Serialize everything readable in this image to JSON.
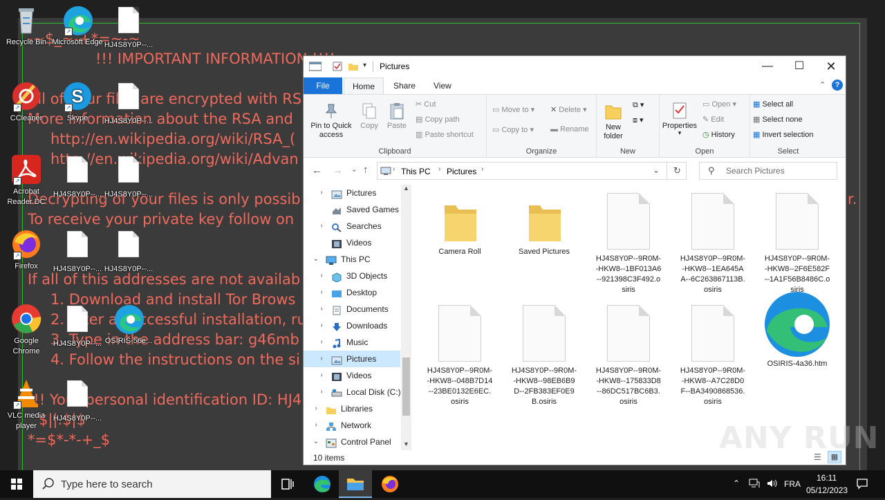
{
  "colors": {
    "note_text": "#f06a5c",
    "note_bg": "#3b3b3b",
    "note_border": "#2dbd2d",
    "accent": "#1a73d9",
    "selected": "#cce8ff"
  },
  "desktop": {
    "note_lines": [
      "-~$_~-+*=~-~",
      "!!! IMPORTANT INFORMATION !!!!",
      "All of your files are encrypted with RS",
      "More information about the RSA and",
      "http://en.wikipedia.org/wiki/RSA_(",
      "http://en.wikipedia.org/wiki/Advan",
      "Decrypting of your files is only possib",
      "To receive your private key follow on",
      "If all of this addresses are not availab",
      "1. Download and install Tor Brows",
      "2. After a successful installation, ru",
      "3. Type in the address bar: g46mb",
      "4. Follow the instructions on the si",
      "!!! Your personal identification ID: HJ4",
      "$||.$|$",
      "*=$*-*-+_$",
      "r."
    ],
    "icons": [
      {
        "label": "Recycle Bin",
        "icon": "recycle-bin-icon"
      },
      {
        "label": "Microsoft Edge",
        "icon": "edge-icon"
      },
      {
        "label": "HJ4S8Y0P--...",
        "icon": "file-icon"
      },
      {
        "label": "CCleaner",
        "icon": "ccleaner-icon"
      },
      {
        "label": "Skype",
        "icon": "skype-icon"
      },
      {
        "label": "HJ4S8Y0P--...",
        "icon": "file-icon"
      },
      {
        "label": "Acrobat Reader DC",
        "icon": "acrobat-icon"
      },
      {
        "label": "HJ4S8Y0P--...",
        "icon": "file-icon"
      },
      {
        "label": "HJ4S8Y0P--...",
        "icon": "file-icon"
      },
      {
        "label": "Firefox",
        "icon": "firefox-icon"
      },
      {
        "label": "HJ4S8Y0P--...",
        "icon": "file-icon"
      },
      {
        "label": "HJ4S8Y0P--...",
        "icon": "file-icon"
      },
      {
        "label": "Google Chrome",
        "icon": "chrome-icon"
      },
      {
        "label": "HJ4S8Y0P--...",
        "icon": "file-icon"
      },
      {
        "label": "OSIRIS-56e...",
        "icon": "edge-icon"
      },
      {
        "label": "VLC media player",
        "icon": "vlc-icon"
      },
      {
        "label": "HJ4S8Y0P--...",
        "icon": "file-icon"
      }
    ]
  },
  "explorer": {
    "title": "Pictures",
    "tabs": [
      "File",
      "Home",
      "Share",
      "View"
    ],
    "active_tab": "Home",
    "ribbon": {
      "clipboard": {
        "group": "Clipboard",
        "pin": "Pin to Quick access",
        "copy": "Copy",
        "paste": "Paste",
        "cut": "Cut",
        "copy_path": "Copy path",
        "paste_shortcut": "Paste shortcut"
      },
      "organize": {
        "group": "Organize",
        "move_to": "Move to",
        "copy_to": "Copy to",
        "delete": "Delete",
        "rename": "Rename"
      },
      "new": {
        "group": "New",
        "new_folder": "New folder"
      },
      "open": {
        "group": "Open",
        "properties": "Properties",
        "open": "Open",
        "edit": "Edit",
        "history": "History"
      },
      "select": {
        "group": "Select",
        "select_all": "Select all",
        "select_none": "Select none",
        "invert": "Invert selection"
      }
    },
    "breadcrumb": [
      "This PC",
      "Pictures"
    ],
    "search_placeholder": "Search Pictures",
    "nav": [
      {
        "label": "Pictures",
        "level": 1,
        "expand": "right",
        "icon": "pictures-folder-icon"
      },
      {
        "label": "Saved Games",
        "level": 1,
        "expand": "",
        "icon": "saved-games-icon"
      },
      {
        "label": "Searches",
        "level": 1,
        "expand": "right",
        "icon": "searches-icon"
      },
      {
        "label": "Videos",
        "level": 1,
        "expand": "",
        "icon": "videos-folder-icon"
      },
      {
        "label": "This PC",
        "level": 0,
        "expand": "down",
        "icon": "this-pc-icon"
      },
      {
        "label": "3D Objects",
        "level": 1,
        "expand": "right",
        "icon": "3d-objects-icon"
      },
      {
        "label": "Desktop",
        "level": 1,
        "expand": "right",
        "icon": "desktop-folder-icon"
      },
      {
        "label": "Documents",
        "level": 1,
        "expand": "right",
        "icon": "documents-folder-icon"
      },
      {
        "label": "Downloads",
        "level": 1,
        "expand": "right",
        "icon": "downloads-folder-icon"
      },
      {
        "label": "Music",
        "level": 1,
        "expand": "right",
        "icon": "music-folder-icon"
      },
      {
        "label": "Pictures",
        "level": 1,
        "expand": "right",
        "icon": "pictures-folder-icon",
        "selected": true
      },
      {
        "label": "Videos",
        "level": 1,
        "expand": "right",
        "icon": "videos-folder-icon"
      },
      {
        "label": "Local Disk (C:)",
        "level": 1,
        "expand": "right",
        "icon": "drive-icon"
      },
      {
        "label": "Libraries",
        "level": 0,
        "expand": "right",
        "icon": "libraries-icon"
      },
      {
        "label": "Network",
        "level": 0,
        "expand": "right",
        "icon": "network-icon"
      },
      {
        "label": "Control Panel",
        "level": 0,
        "expand": "down",
        "icon": "control-panel-icon"
      }
    ],
    "items": [
      {
        "name": "Camera Roll",
        "type": "folder"
      },
      {
        "name": "Saved Pictures",
        "type": "folder"
      },
      {
        "name": "HJ4S8Y0P--9R0M--HKW8--1BF013A6--921398C3F492.osiris",
        "type": "file"
      },
      {
        "name": "HJ4S8Y0P--9R0M--HKW8--1EA645AA--6C263867113B.osiris",
        "type": "file"
      },
      {
        "name": "HJ4S8Y0P--9R0M--HKW8--2F6E582F--1A1F56B8486C.osiris",
        "type": "file"
      },
      {
        "name": "HJ4S8Y0P--9R0M--HKW8--048B7D14--23BE0132E6EC.osiris",
        "type": "file"
      },
      {
        "name": "HJ4S8Y0P--9R0M--HKW8--98EB6B9D--2FB383EF0E9B.osiris",
        "type": "file"
      },
      {
        "name": "HJ4S8Y0P--9R0M--HKW8--175833D8--86DC517BC6B3.osiris",
        "type": "file"
      },
      {
        "name": "HJ4S8Y0P--9R0M--HKW8--A7C28D0F--BA3490868536.osiris",
        "type": "file"
      },
      {
        "name": "OSIRIS-4a36.htm",
        "type": "edge"
      }
    ],
    "status": "10 items"
  },
  "watermark": "ANY RUN",
  "taskbar": {
    "search_placeholder": "Type here to search",
    "language": "FRA",
    "time": "16:11",
    "date": "05/12/2023"
  }
}
